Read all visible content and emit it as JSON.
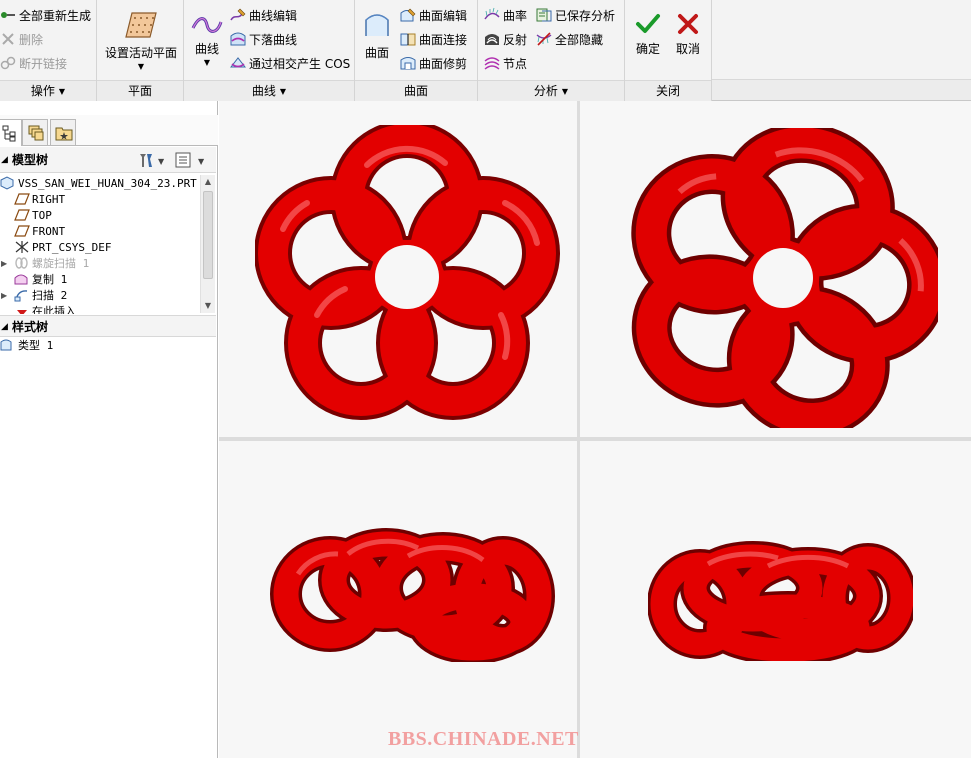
{
  "ribbon": {
    "groups": {
      "operations": {
        "label": "操作",
        "items": [
          "全部重新生成",
          "删除",
          "断开链接"
        ]
      },
      "plane": {
        "label": "平面",
        "set_active_plane": "设置活动平面"
      },
      "curves": {
        "label": "曲线",
        "curve_big": "曲线",
        "items": [
          "曲线编辑",
          "下落曲线",
          "通过相交产生 COS"
        ]
      },
      "surfaces": {
        "label": "曲面",
        "surface_big": "曲面",
        "items": [
          "曲面编辑",
          "曲面连接",
          "曲面修剪"
        ]
      },
      "analysis": {
        "label": "分析",
        "items": [
          "曲率",
          "反射",
          "节点",
          "已保存分析",
          "全部隐藏"
        ]
      },
      "close": {
        "label": "关闭",
        "ok": "确定",
        "cancel": "取消"
      }
    }
  },
  "model_tree": {
    "title": "模型树",
    "items": [
      {
        "label": "VSS_SAN_WEI_HUAN_304_23.PRT"
      },
      {
        "label": "RIGHT"
      },
      {
        "label": "TOP"
      },
      {
        "label": "FRONT"
      },
      {
        "label": "PRT_CSYS_DEF"
      },
      {
        "label": "螺旋扫描 1"
      },
      {
        "label": "复制 1"
      },
      {
        "label": "扫描 2"
      },
      {
        "label": "在此插入"
      }
    ]
  },
  "style_tree": {
    "title": "样式树",
    "items": [
      {
        "label": "类型 1"
      }
    ]
  },
  "colors": {
    "knot": "#e30000",
    "knot_dark": "#7a0000",
    "knot_highlight": "#ff7a7a",
    "ok_check": "#1a9a2a",
    "cancel_x": "#c01818"
  },
  "watermark": "BBS.CHINADE.NET"
}
